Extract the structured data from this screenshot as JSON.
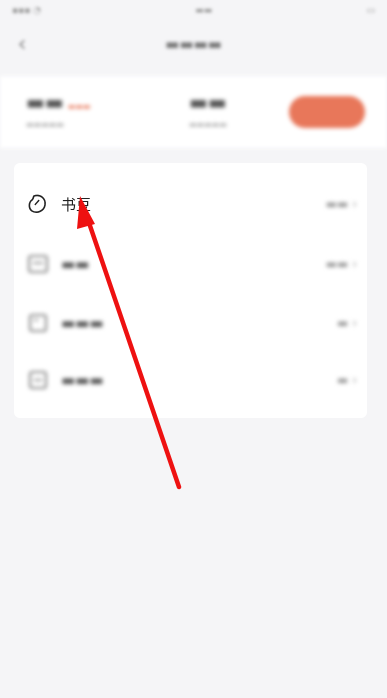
{
  "list": {
    "items": [
      {
        "label": "书豆",
        "value": "",
        "icon": "bean-icon"
      },
      {
        "label": "",
        "value": "",
        "icon": "coupon-icon"
      },
      {
        "label": "",
        "value": "",
        "icon": "ticket-icon"
      },
      {
        "label": "",
        "value": "",
        "icon": "card-icon"
      }
    ]
  },
  "annotation": {
    "color": "#ee1111"
  },
  "colors": {
    "accent": "#e8775a",
    "background": "#f5f5f7"
  }
}
